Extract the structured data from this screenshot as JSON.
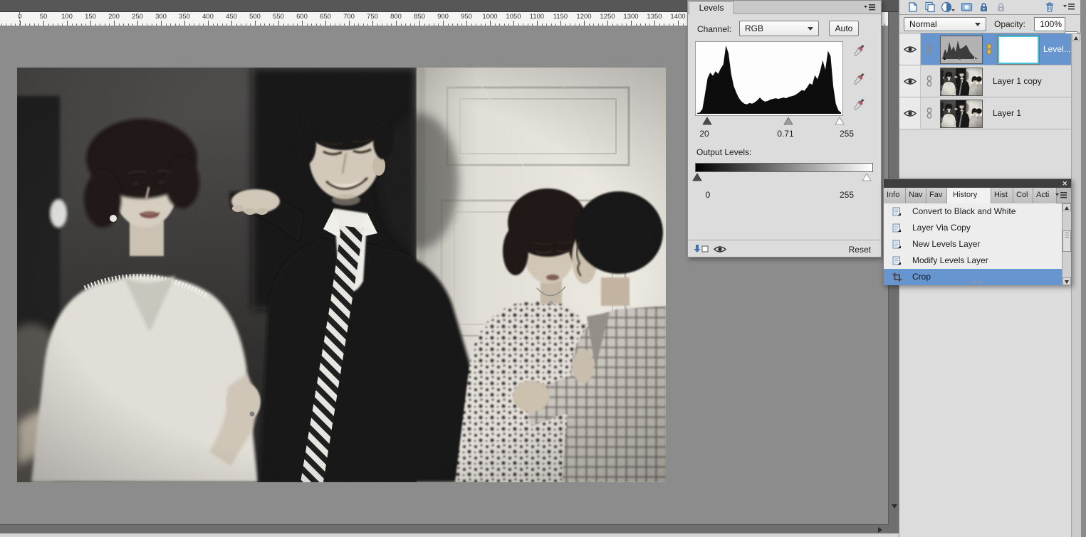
{
  "colors": {
    "selection_blue": "#6795d0",
    "mask_border": "#49c2dc",
    "panel_bg": "#dcdcdc",
    "canvas_bg": "#8c8c8c",
    "scrollbar_grey": "#6f6f6f",
    "titlebar_dark": "#3e3e3e",
    "icon_blue": "#3f74ad",
    "histogram_black": "#0d0d0d"
  },
  "icons": {
    "close_glyph": "✕"
  },
  "ruler": {
    "partial_left_label": "50",
    "labels": [
      "0",
      "50",
      "100",
      "150",
      "200",
      "250",
      "300",
      "350",
      "400",
      "450",
      "500",
      "550",
      "600",
      "650",
      "700",
      "750",
      "800",
      "850",
      "900",
      "950",
      "1000",
      "1050",
      "1100",
      "1150",
      "1200",
      "1250",
      "1300",
      "1350",
      "1400"
    ]
  },
  "levels": {
    "tab_label": "Levels",
    "channel_label": "Channel:",
    "channel_value": "RGB",
    "auto_label": "Auto",
    "input_black": "20",
    "input_gamma": "0.71",
    "input_white": "255",
    "output_label": "Output Levels:",
    "output_black": "0",
    "output_white": "255",
    "reset_label": "Reset",
    "histogram_bins": [
      0,
      1,
      6,
      28,
      52,
      60,
      55,
      62,
      58,
      66,
      72,
      100,
      88,
      58,
      40,
      30,
      22,
      17,
      14,
      13,
      15,
      14,
      16,
      19,
      23,
      19,
      17,
      18,
      20,
      21,
      22,
      21,
      22,
      23,
      22,
      24,
      25,
      26,
      28,
      31,
      34,
      33,
      38,
      44,
      42,
      56,
      50,
      62,
      78,
      64,
      92,
      84,
      40,
      14,
      4,
      1
    ]
  },
  "history": {
    "tabs": [
      "Info",
      "Nav",
      "Fav",
      "History",
      "Hist",
      "Col",
      "Acti"
    ],
    "active_tab": "History",
    "items": [
      {
        "label": "Convert to Black and White"
      },
      {
        "label": "Layer Via Copy"
      },
      {
        "label": "New Levels Layer"
      },
      {
        "label": "Modify Levels Layer"
      },
      {
        "label": "Crop"
      }
    ],
    "selected_item": "Crop"
  },
  "layers": {
    "blend_mode": "Normal",
    "opacity_label": "Opacity:",
    "opacity_value": "100%",
    "rows": [
      {
        "name": "Level...",
        "type": "levels-adjustment",
        "selected": true
      },
      {
        "name": "Layer 1 copy",
        "type": "image",
        "selected": false
      },
      {
        "name": "Layer 1",
        "type": "image",
        "selected": false
      }
    ]
  }
}
